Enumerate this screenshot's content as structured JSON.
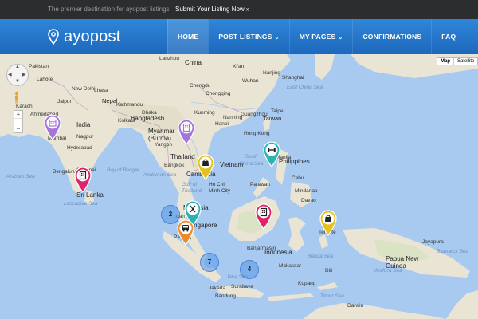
{
  "topbar": {
    "tagline": "The premier destination for ayopost listings.",
    "cta": "Submit Your Listing Now »"
  },
  "brand": {
    "name": "ayopost"
  },
  "nav": [
    {
      "label": "HOME",
      "active": true,
      "caret": ""
    },
    {
      "label": "POST LISTINGS",
      "active": false,
      "caret": "⌄"
    },
    {
      "label": "MY PAGES",
      "active": false,
      "caret": "⌄"
    },
    {
      "label": "CONFIRMATIONS",
      "active": false,
      "caret": ""
    },
    {
      "label": "FAQ",
      "active": false,
      "caret": ""
    }
  ],
  "map": {
    "type_buttons": [
      "Map",
      "Satellite"
    ],
    "zoom": {
      "in": "+",
      "out": "−"
    },
    "labels": {
      "china": "China",
      "pakistan": "Pakistan",
      "india": "India",
      "nepal": "Nepal",
      "bangladesh": "Bangladesh",
      "myanmar": "Myanmar\n(Burma)",
      "thailand": "Thailand",
      "cambodia": "Cambodia",
      "vietnam": "Vietnam",
      "philippines": "Philippines",
      "taiwan": "Taiwan",
      "malaysia": "Malaysia",
      "singapore": "Singapore",
      "indonesia": "Indonesia",
      "papua": "Papua New\nGuinea",
      "srilanka": "Sri Lanka",
      "arabian_sea": "Arabian Sea",
      "bay_of_bengal": "Bay of Bengal",
      "laccadive": "Laccadive Sea",
      "south_china_sea": "South\nChina Sea",
      "east_china_sea": "East China Sea",
      "java_sea": "Java Sea",
      "banda_sea": "Banda Sea",
      "arafura_sea": "Arafura Sea",
      "timor_sea": "Timor Sea",
      "bismarck": "Bismarck Sea",
      "gulf_thailand": "Gulf of\nThailand",
      "andaman": "Andaman Sea",
      "karachi": "Karachi",
      "new_delhi": "New Delhi",
      "mumbai": "Mumbai",
      "hyderabad": "Hyderabad",
      "bengaluru": "Bengaluru",
      "chennai": "Chennai",
      "kolkata": "Kolkata",
      "dhaka": "Dhaka",
      "yangon": "Yangon",
      "bangkok": "Bangkok",
      "hanoi": "Hanoi",
      "hong_kong": "Hong Kong",
      "manila": "Manila",
      "hcm": "Ho Chi\nMinh City",
      "jakarta": "Jakarta",
      "surabaya": "Surabaya",
      "chengdu": "Chengdu",
      "chongqing": "Chongqing",
      "wuhan": "Wuhan",
      "shanghai": "Shanghai",
      "guangzhou": "Guangzhou",
      "kunming": "Kunming",
      "lahore": "Lahore",
      "nanning": "Nanning",
      "taipei": "Taipei",
      "nanjing": "Nanjing",
      "xian": "Xi'an",
      "lanzhou": "Lanzhou",
      "lhasa": "Lhasa",
      "kathmandu": "Kathmandu",
      "jaipur": "Jaipur",
      "ahmedabad": "Ahmedabad",
      "nagpur": "Nagpur",
      "davao": "Davao",
      "cebu": "Cebu",
      "palawan": "Palawan",
      "mindanao": "Mindanao",
      "makassar": "Makassar",
      "bandung": "Bandung",
      "dili": "Dili",
      "darwin": "Darwin",
      "kupang": "Kupang",
      "banjarmasin": "Banjarmasin",
      "padang": "Padang",
      "medan": "Medan",
      "ternate": "Ternate",
      "jayapura": "Jayapura"
    },
    "clusters": [
      {
        "count": "2"
      },
      {
        "count": "7"
      },
      {
        "count": "4"
      }
    ],
    "markers": {
      "mumbai": {
        "icon": "calendar-icon",
        "color": "#a675db"
      },
      "myanmar": {
        "icon": "building-icon",
        "color": "#a675db"
      },
      "cambodia": {
        "icon": "shopping-bag-icon",
        "color": "#e6c020"
      },
      "manila": {
        "icon": "dumbbell-icon",
        "color": "#2bb3b3"
      },
      "srilanka": {
        "icon": "building-icon",
        "color": "#e0236a"
      },
      "malaysia": {
        "icon": "restaurant-icon",
        "color": "#2bb3b3"
      },
      "singapore": {
        "icon": "bus-icon",
        "color": "#ef8a2a"
      },
      "borneo": {
        "icon": "building-icon",
        "color": "#e0236a"
      },
      "papua": {
        "icon": "shopping-bag-icon",
        "color": "#e6c020"
      }
    }
  }
}
